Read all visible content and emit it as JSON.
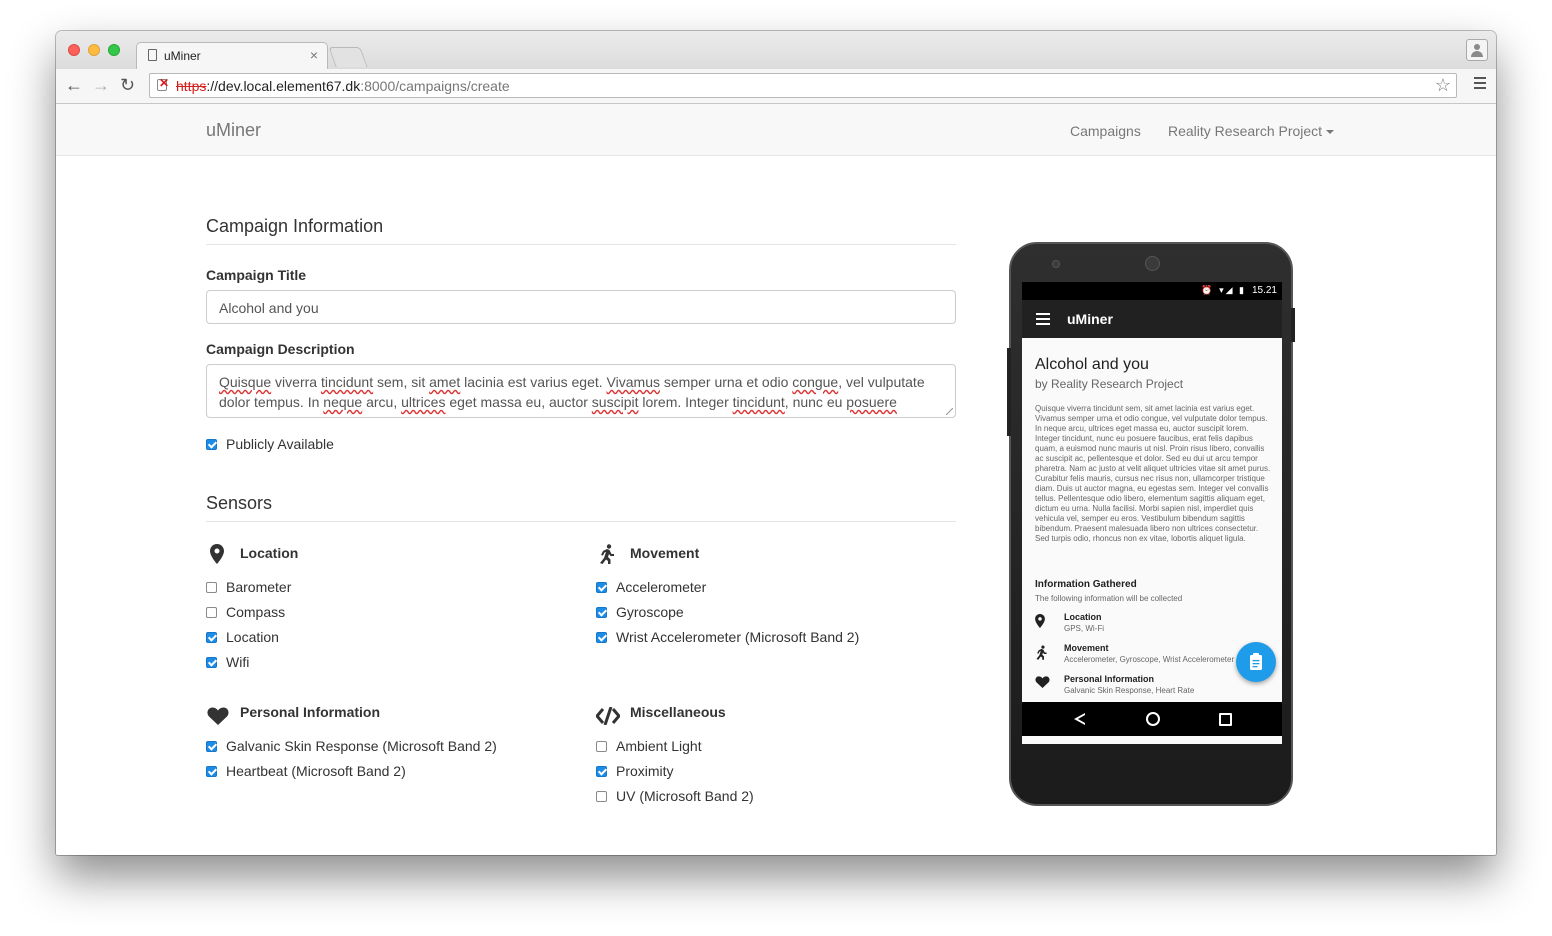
{
  "browser": {
    "tab_title": "uMiner",
    "tab_close": "×",
    "url_scheme": "https",
    "url_host": "://dev.local.element67.dk",
    "url_rest": ":8000/campaigns/create",
    "back_icon": "←",
    "forward_icon": "→",
    "reload_icon": "↻",
    "star_icon": "☆"
  },
  "navbar": {
    "brand": "uMiner",
    "links": [
      "Campaigns",
      "Reality Research Project"
    ]
  },
  "campaign_info": {
    "heading": "Campaign Information",
    "title_label": "Campaign Title",
    "title_value": "Alcohol and you",
    "description_label": "Campaign Description",
    "description_value": "Quisque viverra tincidunt sem, sit amet lacinia est varius eget. Vivamus semper urna et odio congue, vel vulputate dolor tempus. In neque arcu, ultrices eget massa eu, auctor suscipit lorem. Integer tincidunt, nunc eu posuere faucibus, erat felis dapibus quam, a euismod nunc mauris ut nisl.",
    "public_label": "Publicly Available",
    "public_checked": true
  },
  "sensors": {
    "heading": "Sensors",
    "groups": [
      {
        "title": "Location",
        "icon": "map-pin-icon",
        "items": [
          {
            "label": "Barometer",
            "checked": false
          },
          {
            "label": "Compass",
            "checked": false
          },
          {
            "label": "Location",
            "checked": true
          },
          {
            "label": "Wifi",
            "checked": true
          }
        ]
      },
      {
        "title": "Movement",
        "icon": "running-person-icon",
        "items": [
          {
            "label": "Accelerometer",
            "checked": true
          },
          {
            "label": "Gyroscope",
            "checked": true
          },
          {
            "label": "Wrist Accelerometer (Microsoft Band 2)",
            "checked": true
          }
        ]
      },
      {
        "title": "Personal Information",
        "icon": "heart-icon",
        "items": [
          {
            "label": "Galvanic Skin Response (Microsoft Band 2)",
            "checked": true
          },
          {
            "label": "Heartbeat (Microsoft Band 2)",
            "checked": true
          }
        ]
      },
      {
        "title": "Miscellaneous",
        "icon": "code-icon",
        "items": [
          {
            "label": "Ambient Light",
            "checked": false
          },
          {
            "label": "Proximity",
            "checked": true
          },
          {
            "label": "UV (Microsoft Band 2)",
            "checked": false
          }
        ]
      }
    ]
  },
  "phone": {
    "time": "15.21",
    "status_icons": "⏰ ▾◢ ▮",
    "app_title": "uMiner",
    "campaign_title": "Alcohol and you",
    "byline": "by Reality Research Project",
    "body": "Quisque viverra tincidunt sem, sit amet lacinia est varius eget. Vivamus semper urna et odio congue, vel vulputate dolor tempus. In neque arcu, ultrices eget massa eu, auctor suscipit lorem. Integer tincidunt, nunc eu posuere faucibus, erat felis dapibus quam, a euismod nunc mauris ut nisl. Proin risus libero, convallis ac suscipit ac, pellentesque et dolor. Sed eu dui ut arcu tempor pharetra. Nam ac justo at velit aliquet ultricies vitae sit amet purus. Curabitur felis mauris, cursus nec risus non, ullamcorper tristique diam. Duis ut auctor magna, eu egestas sem. Integer vel convallis tellus. Pellentesque odio libero, elementum sagittis aliquam eget, dictum eu urna. Nulla facilisi. Morbi sapien nisl, imperdiet quis vehicula vel, semper eu eros. Vestibulum bibendum sagittis bibendum. Praesent malesuada libero non ultrices consectetur. Sed turpis odio, rhoncus non ex vitae, lobortis aliquet ligula.",
    "info_title": "Information Gathered",
    "info_sub": "The following information will be collected",
    "items": [
      {
        "title": "Location",
        "detail": "GPS, Wi-Fi"
      },
      {
        "title": "Movement",
        "detail": "Accelerometer, Gyroscope, Wrist Accelerometer"
      },
      {
        "title": "Personal Information",
        "detail": "Galvanic Skin Response, Heart Rate"
      }
    ]
  }
}
